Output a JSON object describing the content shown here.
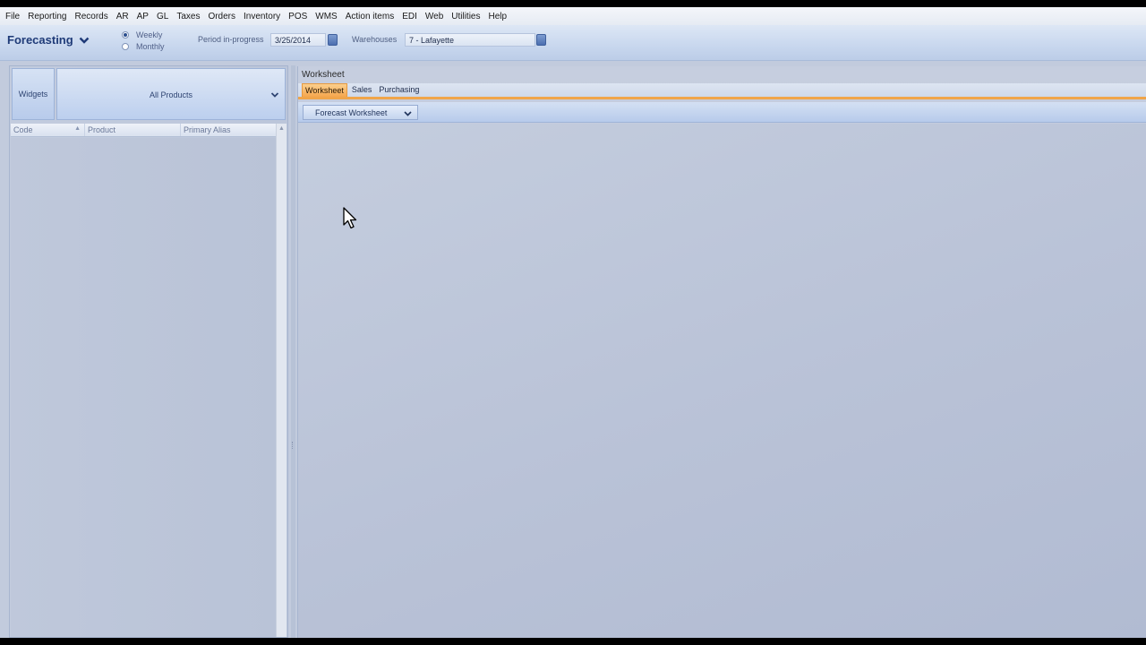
{
  "menu": [
    "File",
    "Reporting",
    "Records",
    "AR",
    "AP",
    "GL",
    "Taxes",
    "Orders",
    "Inventory",
    "POS",
    "WMS",
    "Action items",
    "EDI",
    "Web",
    "Utilities",
    "Help"
  ],
  "toolbar": {
    "module": "Forecasting",
    "period_weekly": "Weekly",
    "period_monthly": "Monthly",
    "period_in_progress_label": "Period in-progress",
    "period_in_progress_value": "3/25/2014",
    "warehouses_label": "Warehouses",
    "warehouses_value": "7 - Lafayette"
  },
  "left_panel": {
    "widgets_label": "Widgets",
    "products_filter": "All Products",
    "columns": [
      "Code",
      "Product",
      "Primary Alias"
    ]
  },
  "right_panel": {
    "title": "Worksheet",
    "tabs": [
      "Worksheet",
      "Sales",
      "Purchasing"
    ],
    "active_tab": "Worksheet",
    "view_selector": "Forecast Worksheet"
  },
  "colors": {
    "accent_orange": "#f5a64d",
    "title_blue": "#1f3b78",
    "panel_bg": "#c2cbdd"
  }
}
